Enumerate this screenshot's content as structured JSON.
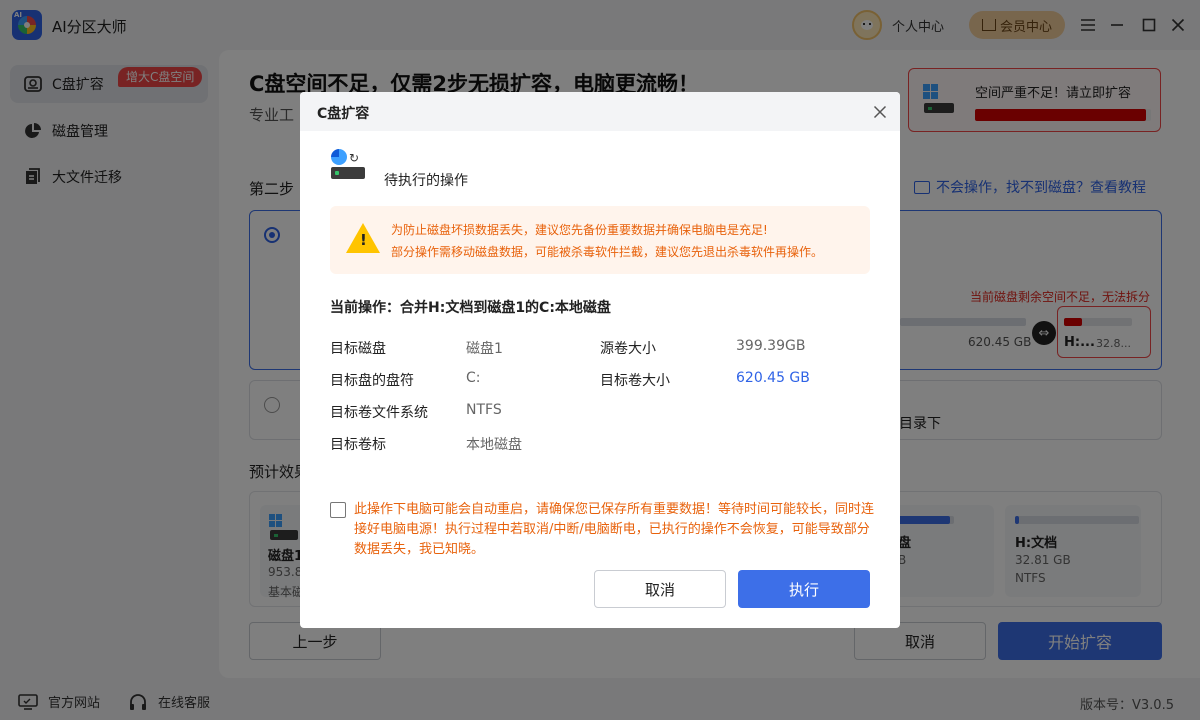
{
  "app": {
    "title": "AI分区大师",
    "logo_icon": "app-logo-icon"
  },
  "header": {
    "user_center": "个人中心",
    "vip_center": "会员中心"
  },
  "sidebar": {
    "items": [
      {
        "label": "C盘扩容",
        "icon": "disk-icon",
        "active": true
      },
      {
        "label": "磁盘管理",
        "icon": "pie-chart-icon"
      },
      {
        "label": "大文件迁移",
        "icon": "file-transfer-icon"
      }
    ],
    "promo_badge": "增大C盘空间"
  },
  "footer": {
    "website": "官方网站",
    "support": "在线客服",
    "version": "版本号：V3.0.5"
  },
  "main": {
    "headline": "C盘空间不足，仅需2步无损扩容，电脑更流畅！",
    "subline_visible": "专业工",
    "space_warning": {
      "text": "空间严重不足！请立即扩容",
      "used_fraction": 0.97
    },
    "step_label_visible": "第二步",
    "help_link": "不会操作，找不到磁盘？查看教程",
    "option1": {
      "red_note": "当前磁盘剩余空间不足，无法拆分",
      "size_visible": "620.45 GB",
      "target_card": {
        "name_visible": "H:...",
        "size_visible": "32.8..."
      }
    },
    "option2": {
      "text_visible": "目录下"
    },
    "preview_label_visible": "预计效果",
    "preview_cards": [
      {
        "name_visible": "磁盘1",
        "size_visible": "953.8",
        "type_visible": "基本磁"
      },
      {
        "name_visible": "盘",
        "size_visible": "B"
      },
      {
        "name": "H:文档",
        "size": "32.81 GB",
        "fs": "NTFS"
      }
    ],
    "buttons": {
      "prev": "上一步",
      "cancel": "取消",
      "start": "开始扩容"
    }
  },
  "modal": {
    "title": "C盘扩容",
    "op_title": "待执行的操作",
    "notice": {
      "line1": "为防止磁盘坏损数据丢失，建议您先备份重要数据并确保电脑电是充足!",
      "line2": "部分操作需移动磁盘数据，可能被杀毒软件拦截，建议您先退出杀毒软件再操作。"
    },
    "current_operation": "当前操作：合并H:文档到磁盘1的C:本地磁盘",
    "details": {
      "target_disk_label": "目标磁盘",
      "target_disk_value": "磁盘1",
      "source_size_label": "源卷大小",
      "source_size_value": "399.39GB",
      "drive_letter_label": "目标盘的盘符",
      "drive_letter_value": "C:",
      "target_size_label": "目标卷大小",
      "target_size_value": "620.45 GB",
      "fs_label": "目标卷文件系统",
      "fs_value": "NTFS",
      "volume_label_label": "目标卷标",
      "volume_label_value": "本地磁盘"
    },
    "consent": "此操作下电脑可能会自动重启，请确保您已保存所有重要数据！等待时间可能较长，同时连接好电脑电源！执行过程中若取消/中断/电脑断电，已执行的操作不会恢复，可能导致部分数据丢失，我已知晓。",
    "cancel": "取消",
    "execute": "执行"
  },
  "colors": {
    "accent": "#3d6fe8",
    "warning": "#e8620c",
    "danger": "#d40000"
  }
}
